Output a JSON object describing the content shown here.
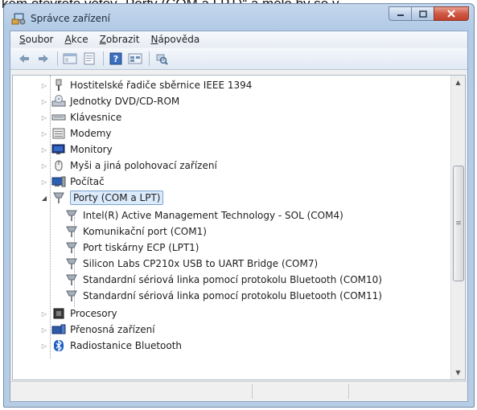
{
  "caption": "kém otevřete větev „Porty (COM a LPT)“ a mělo by se v",
  "window": {
    "title": "Správce zařízení"
  },
  "menu": [
    {
      "first": "S",
      "rest": "oubor"
    },
    {
      "first": "A",
      "rest": "kce"
    },
    {
      "first": "Z",
      "rest": "obrazit"
    },
    {
      "first": "N",
      "rest": "ápověda"
    }
  ],
  "toolbar": {
    "icons": [
      "back-arrow-icon",
      "forward-arrow-icon",
      "console-tree-icon",
      "properties-icon",
      "help-icon",
      "view-icon",
      "scan-hardware-icon"
    ]
  },
  "tree": {
    "top_categories": [
      {
        "label": "Hostitelské řadiče sběrnice IEEE 1394",
        "icon": "ieee1394-icon"
      },
      {
        "label": "Jednotky DVD/CD-ROM",
        "icon": "dvd-drive-icon"
      },
      {
        "label": "Klávesnice",
        "icon": "keyboard-icon"
      },
      {
        "label": "Modemy",
        "icon": "modem-icon"
      },
      {
        "label": "Monitory",
        "icon": "monitor-icon"
      },
      {
        "label": "Myši a jiná polohovací zařízení",
        "icon": "mouse-icon"
      },
      {
        "label": "Počítač",
        "icon": "computer-icon"
      }
    ],
    "expanded": {
      "label": "Porty (COM a LPT)",
      "icon": "port-icon",
      "children": [
        "Intel(R) Active Management Technology - SOL (COM4)",
        "Komunikační port (COM1)",
        "Port tiskárny ECP (LPT1)",
        "Silicon Labs CP210x USB to UART Bridge (COM7)",
        "Standardní sériová linka pomocí protokolu Bluetooth (COM10)",
        "Standardní sériová linka pomocí protokolu Bluetooth (COM11)"
      ]
    },
    "bottom_categories": [
      {
        "label": "Procesory",
        "icon": "processor-icon"
      },
      {
        "label": "Přenosná zařízení",
        "icon": "portable-device-icon"
      },
      {
        "label": "Radiostanice Bluetooth",
        "icon": "bluetooth-icon"
      }
    ]
  },
  "colors": {
    "selection": "#dcebfc",
    "title_bar": "#b3cbe6",
    "close_button": "#c1412b"
  }
}
